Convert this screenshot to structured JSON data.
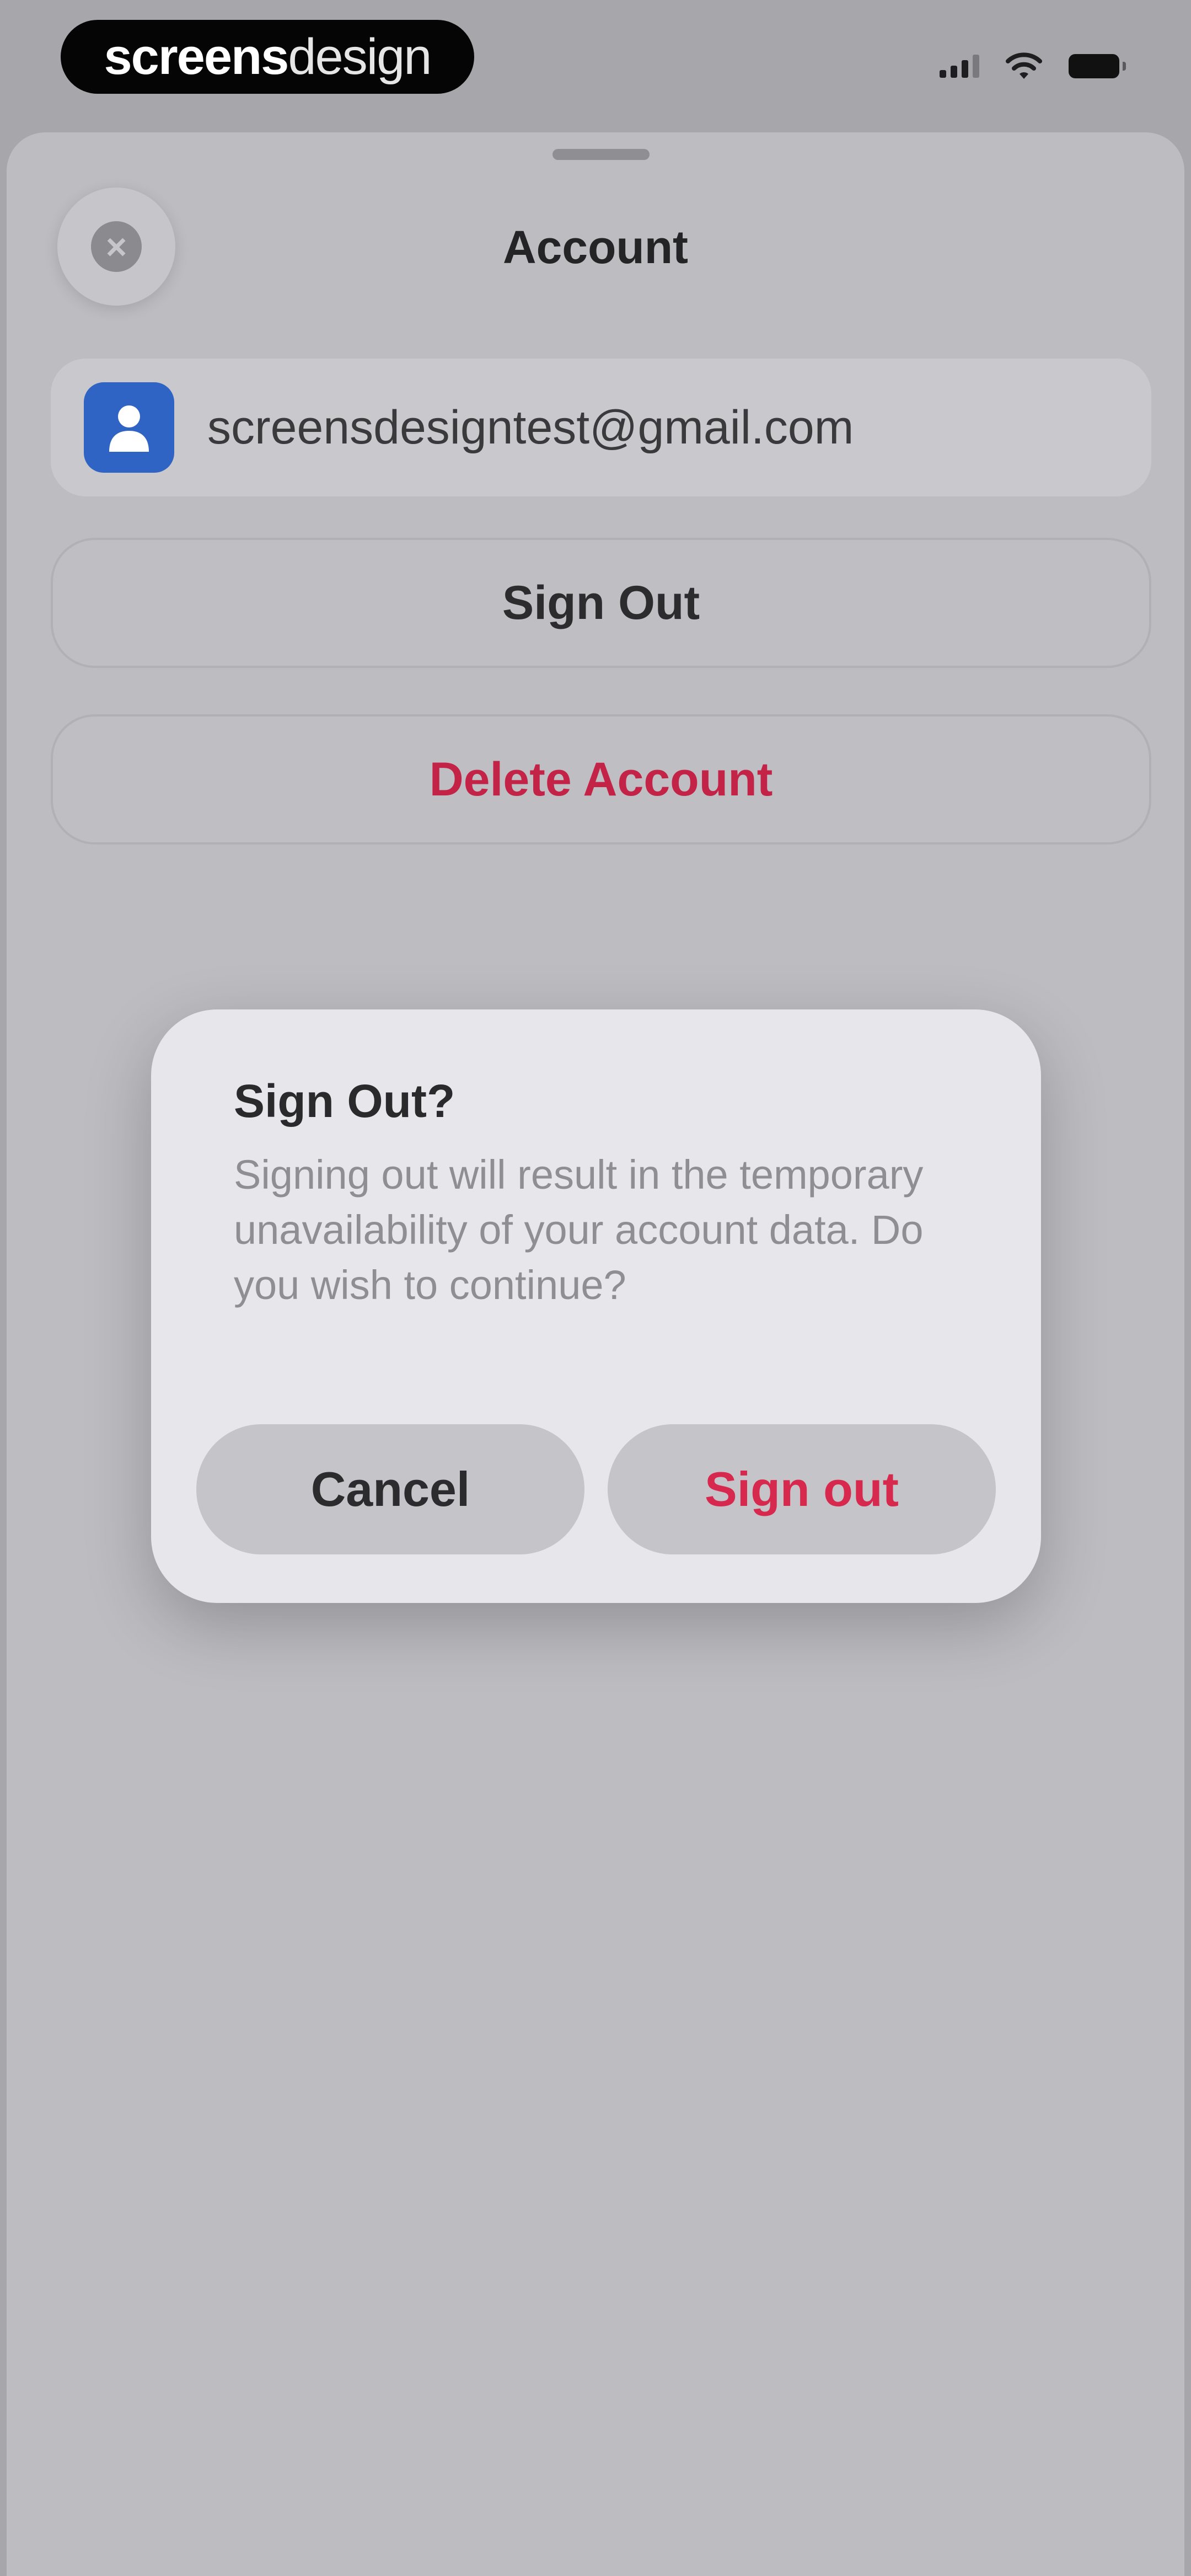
{
  "status_bar": {
    "brand_bold": "screens",
    "brand_light": "design"
  },
  "sheet": {
    "title": "Account",
    "email": "screensdesigntest@gmail.com",
    "sign_out_label": "Sign Out",
    "delete_label": "Delete Account"
  },
  "alert": {
    "title": "Sign Out?",
    "message": "Signing out will result in the temporary unavailability of your account data. Do you wish to continue?",
    "cancel_label": "Cancel",
    "confirm_label": "Sign out"
  },
  "icons": {
    "close": "close-icon",
    "avatar": "person-icon",
    "signal": "cellular-signal-icon",
    "wifi": "wifi-icon",
    "battery": "battery-icon"
  },
  "colors": {
    "avatar": "#2f63c4",
    "destructive": "#d7284d",
    "overlay_bg": "#a7a7ab",
    "alert_bg": "#e6e6eb"
  }
}
